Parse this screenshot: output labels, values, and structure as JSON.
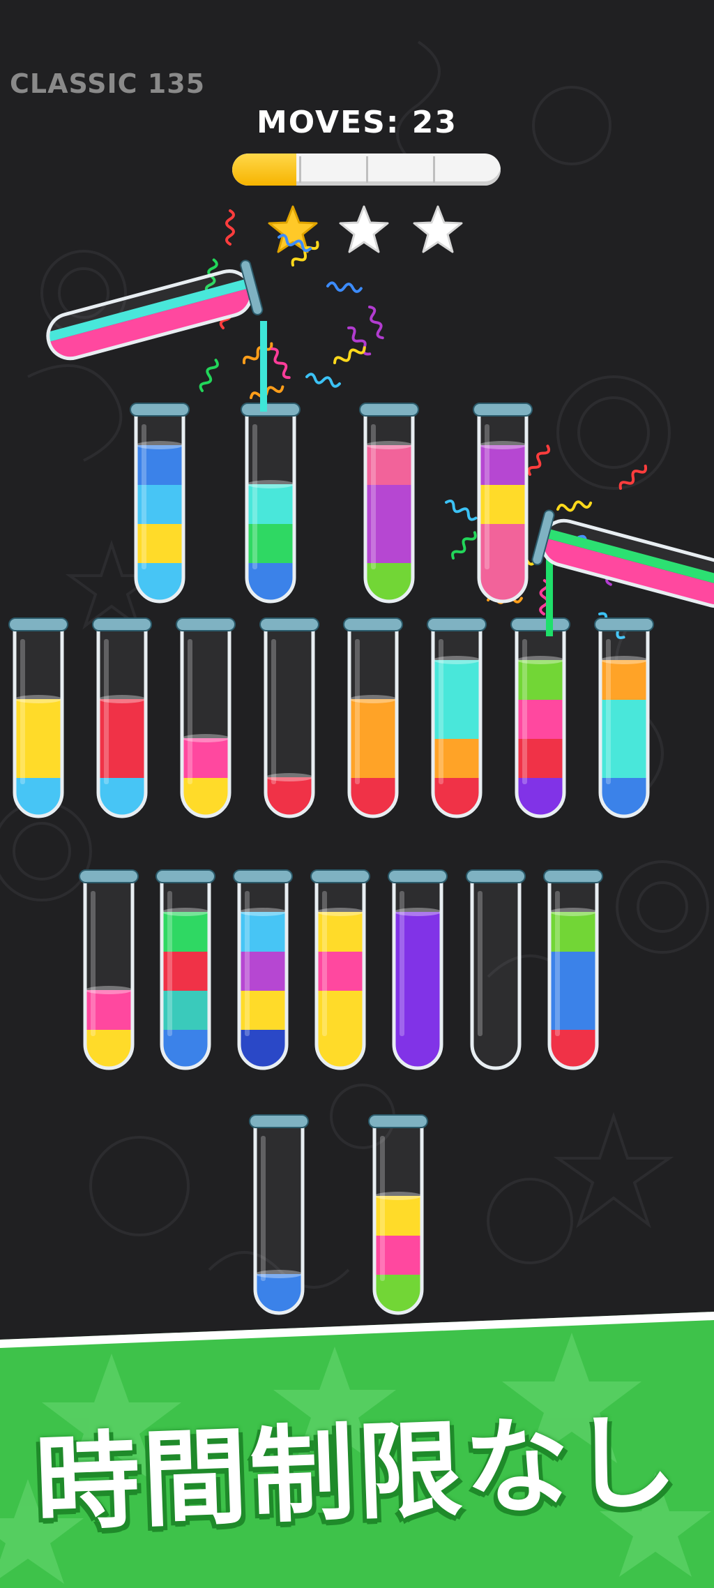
{
  "header": {
    "level_label": "CLASSIC 135",
    "moves_label": "MOVES: 23"
  },
  "progress": {
    "fraction": 0.24,
    "segments": 4
  },
  "stars": {
    "total": 3,
    "earned": 1,
    "earned_color": "#ffc928",
    "empty_color": "#ffffff"
  },
  "colors": {
    "blue": "#2f7be8",
    "skyblue": "#3cc2f5",
    "yellow": "#ffd91c",
    "cyan": "#3ee6d8",
    "green": "#22d65a",
    "pink": "#ff3d9a",
    "rosepink": "#f25a94",
    "purple": "#b23cd0",
    "violet": "#7a27e6",
    "lime": "#6ad42a",
    "red": "#f0263c",
    "orange": "#ff9e1a",
    "teal": "#2ec7b7",
    "navy": "#1d3dc4",
    "emerald": "#1fdf6a",
    "gold": "#ffcc1a"
  },
  "tubes": [
    {
      "id": "t1",
      "layers": [
        "skyblue",
        "yellow",
        "skyblue",
        "blue"
      ]
    },
    {
      "id": "t2",
      "layers": [
        "blue",
        "green",
        "cyan"
      ]
    },
    {
      "id": "t3",
      "layers": [
        "lime",
        "purple",
        "purple",
        "rosepink"
      ]
    },
    {
      "id": "t4",
      "layers": [
        "rosepink",
        "rosepink",
        "yellow",
        "purple"
      ]
    },
    {
      "id": "t5",
      "layers": [
        "skyblue",
        "yellow",
        "yellow"
      ]
    },
    {
      "id": "t6",
      "layers": [
        "skyblue",
        "red",
        "red"
      ]
    },
    {
      "id": "t7",
      "layers": [
        "yellow",
        "pink"
      ]
    },
    {
      "id": "t8",
      "layers": [
        "red"
      ]
    },
    {
      "id": "t9",
      "layers": [
        "red",
        "orange",
        "orange"
      ]
    },
    {
      "id": "t10",
      "layers": [
        "red",
        "orange",
        "cyan",
        "cyan"
      ]
    },
    {
      "id": "t11",
      "layers": [
        "violet",
        "red",
        "pink",
        "lime"
      ]
    },
    {
      "id": "t12",
      "layers": [
        "blue",
        "cyan",
        "cyan",
        "orange"
      ]
    },
    {
      "id": "t13",
      "layers": [
        "yellow",
        "pink"
      ]
    },
    {
      "id": "t14",
      "layers": [
        "blue",
        "teal",
        "red",
        "green"
      ]
    },
    {
      "id": "t15",
      "layers": [
        "navy",
        "yellow",
        "purple",
        "skyblue"
      ]
    },
    {
      "id": "t16",
      "layers": [
        "yellow",
        "yellow",
        "pink",
        "yellow"
      ]
    },
    {
      "id": "t17",
      "layers": [
        "violet",
        "violet",
        "violet",
        "violet"
      ]
    },
    {
      "id": "t18",
      "layers": []
    },
    {
      "id": "t19",
      "layers": [
        "red",
        "blue",
        "blue",
        "lime"
      ]
    },
    {
      "id": "t20",
      "layers": [
        "blue"
      ]
    },
    {
      "id": "t21",
      "layers": [
        "lime",
        "pink",
        "yellow"
      ]
    }
  ],
  "pouring": [
    {
      "id": "pour-left",
      "layers": [
        "pink",
        "cyan"
      ],
      "stream": "cyan"
    },
    {
      "id": "pour-right",
      "layers": [
        "pink",
        "emerald"
      ],
      "stream": "emerald"
    }
  ],
  "banner": {
    "text": "時間制限なし",
    "color": "#3ec24a"
  }
}
